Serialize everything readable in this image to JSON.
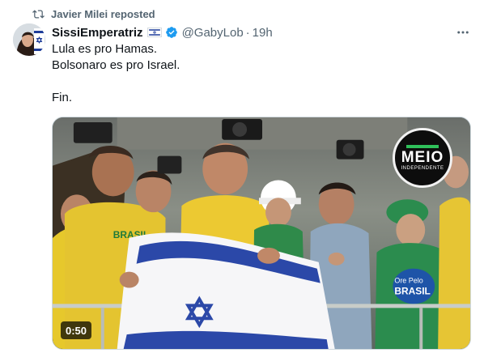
{
  "repost": {
    "text": "Javier Milei reposted",
    "icon": "repost-icon"
  },
  "author": {
    "display_name": "SissiEmperatriz",
    "handle": "@GabyLob",
    "separator": "·",
    "time": "19h",
    "flag_icon": "israel-flag-icon",
    "verified_icon": "verified-badge-icon",
    "verified_color": "#1d9bf0"
  },
  "more_icon": "more-options-icon",
  "tweet": {
    "lines": [
      "Lula es pro Hamas.",
      "Bolsonaro es pro Israel.",
      "",
      "Fin."
    ]
  },
  "media": {
    "type": "video",
    "duration": "0:50",
    "logo": {
      "word": "MEIO",
      "sub": "INDEPENDENTE"
    },
    "shirt_text": "BRASIL",
    "cap_text": "Ore Pelo"
  },
  "colors": {
    "text_primary": "#0f1419",
    "text_secondary": "#536471",
    "accent": "#1d9bf0",
    "israel_blue": "#1e3d9a"
  }
}
